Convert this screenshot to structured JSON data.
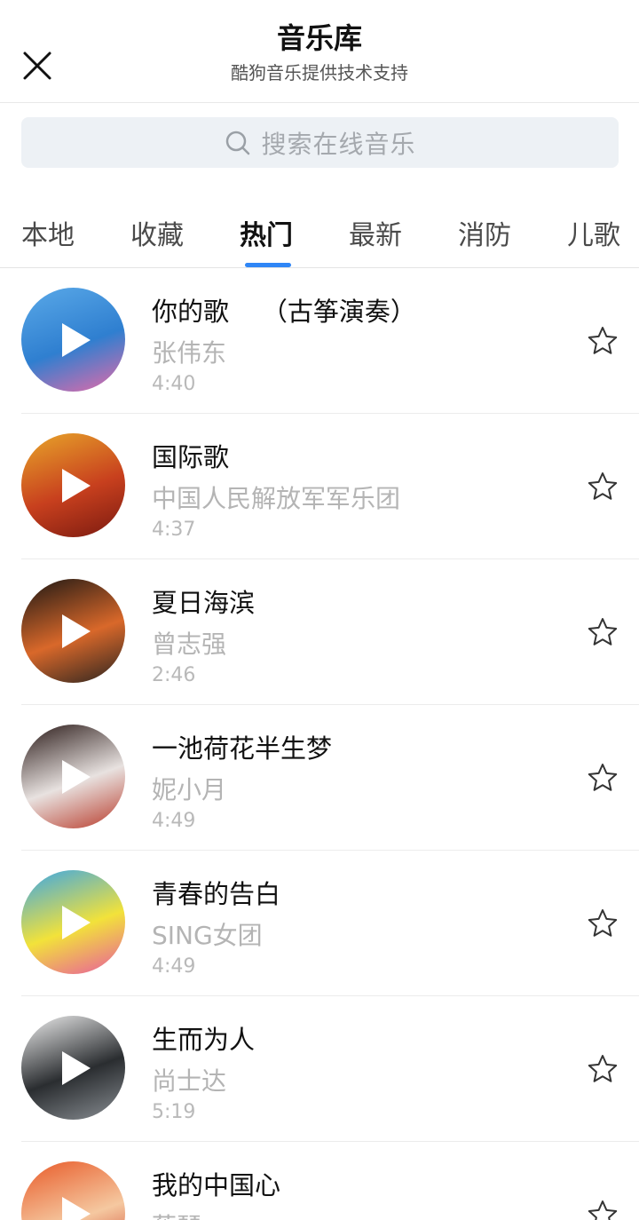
{
  "header": {
    "title": "音乐库",
    "subtitle": "酷狗音乐提供技术支持"
  },
  "search": {
    "placeholder": "搜索在线音乐"
  },
  "tabs": [
    {
      "label": "本地",
      "active": false
    },
    {
      "label": "收藏",
      "active": false
    },
    {
      "label": "热门",
      "active": true
    },
    {
      "label": "最新",
      "active": false
    },
    {
      "label": "消防",
      "active": false
    },
    {
      "label": "儿歌",
      "active": false
    }
  ],
  "accent_color": "#2f86f6",
  "songs": [
    {
      "title": "你的歌    （古筝演奏）",
      "artist": "张伟东",
      "duration": "4:40",
      "favorited": false,
      "cover_colors": [
        "#5aa9e8",
        "#2f7fd0",
        "#e86aa8"
      ]
    },
    {
      "title": "国际歌",
      "artist": "中国人民解放军军乐团",
      "duration": "4:37",
      "favorited": false,
      "cover_colors": [
        "#e8a62a",
        "#c8401e",
        "#7a1a10"
      ]
    },
    {
      "title": "夏日海滨",
      "artist": "曾志强",
      "duration": "2:46",
      "favorited": false,
      "cover_colors": [
        "#1b1714",
        "#d9682a",
        "#2a2420"
      ]
    },
    {
      "title": "一池荷花半生梦",
      "artist": "妮小月",
      "duration": "4:49",
      "favorited": false,
      "cover_colors": [
        "#2a1a18",
        "#e8e2e0",
        "#b83a2a"
      ]
    },
    {
      "title": "青春的告白",
      "artist": "SING女团",
      "duration": "4:49",
      "favorited": false,
      "cover_colors": [
        "#3aa6e8",
        "#f2e23a",
        "#e85aa0"
      ]
    },
    {
      "title": "生而为人",
      "artist": "尚士达",
      "duration": "5:19",
      "favorited": false,
      "cover_colors": [
        "#eeeeee",
        "#2a2d30",
        "#8a8f94"
      ]
    },
    {
      "title": "我的中国心",
      "artist": "蔡琴",
      "duration": "",
      "favorited": false,
      "cover_colors": [
        "#e85a28",
        "#f5c8a0",
        "#c8301a"
      ]
    }
  ]
}
